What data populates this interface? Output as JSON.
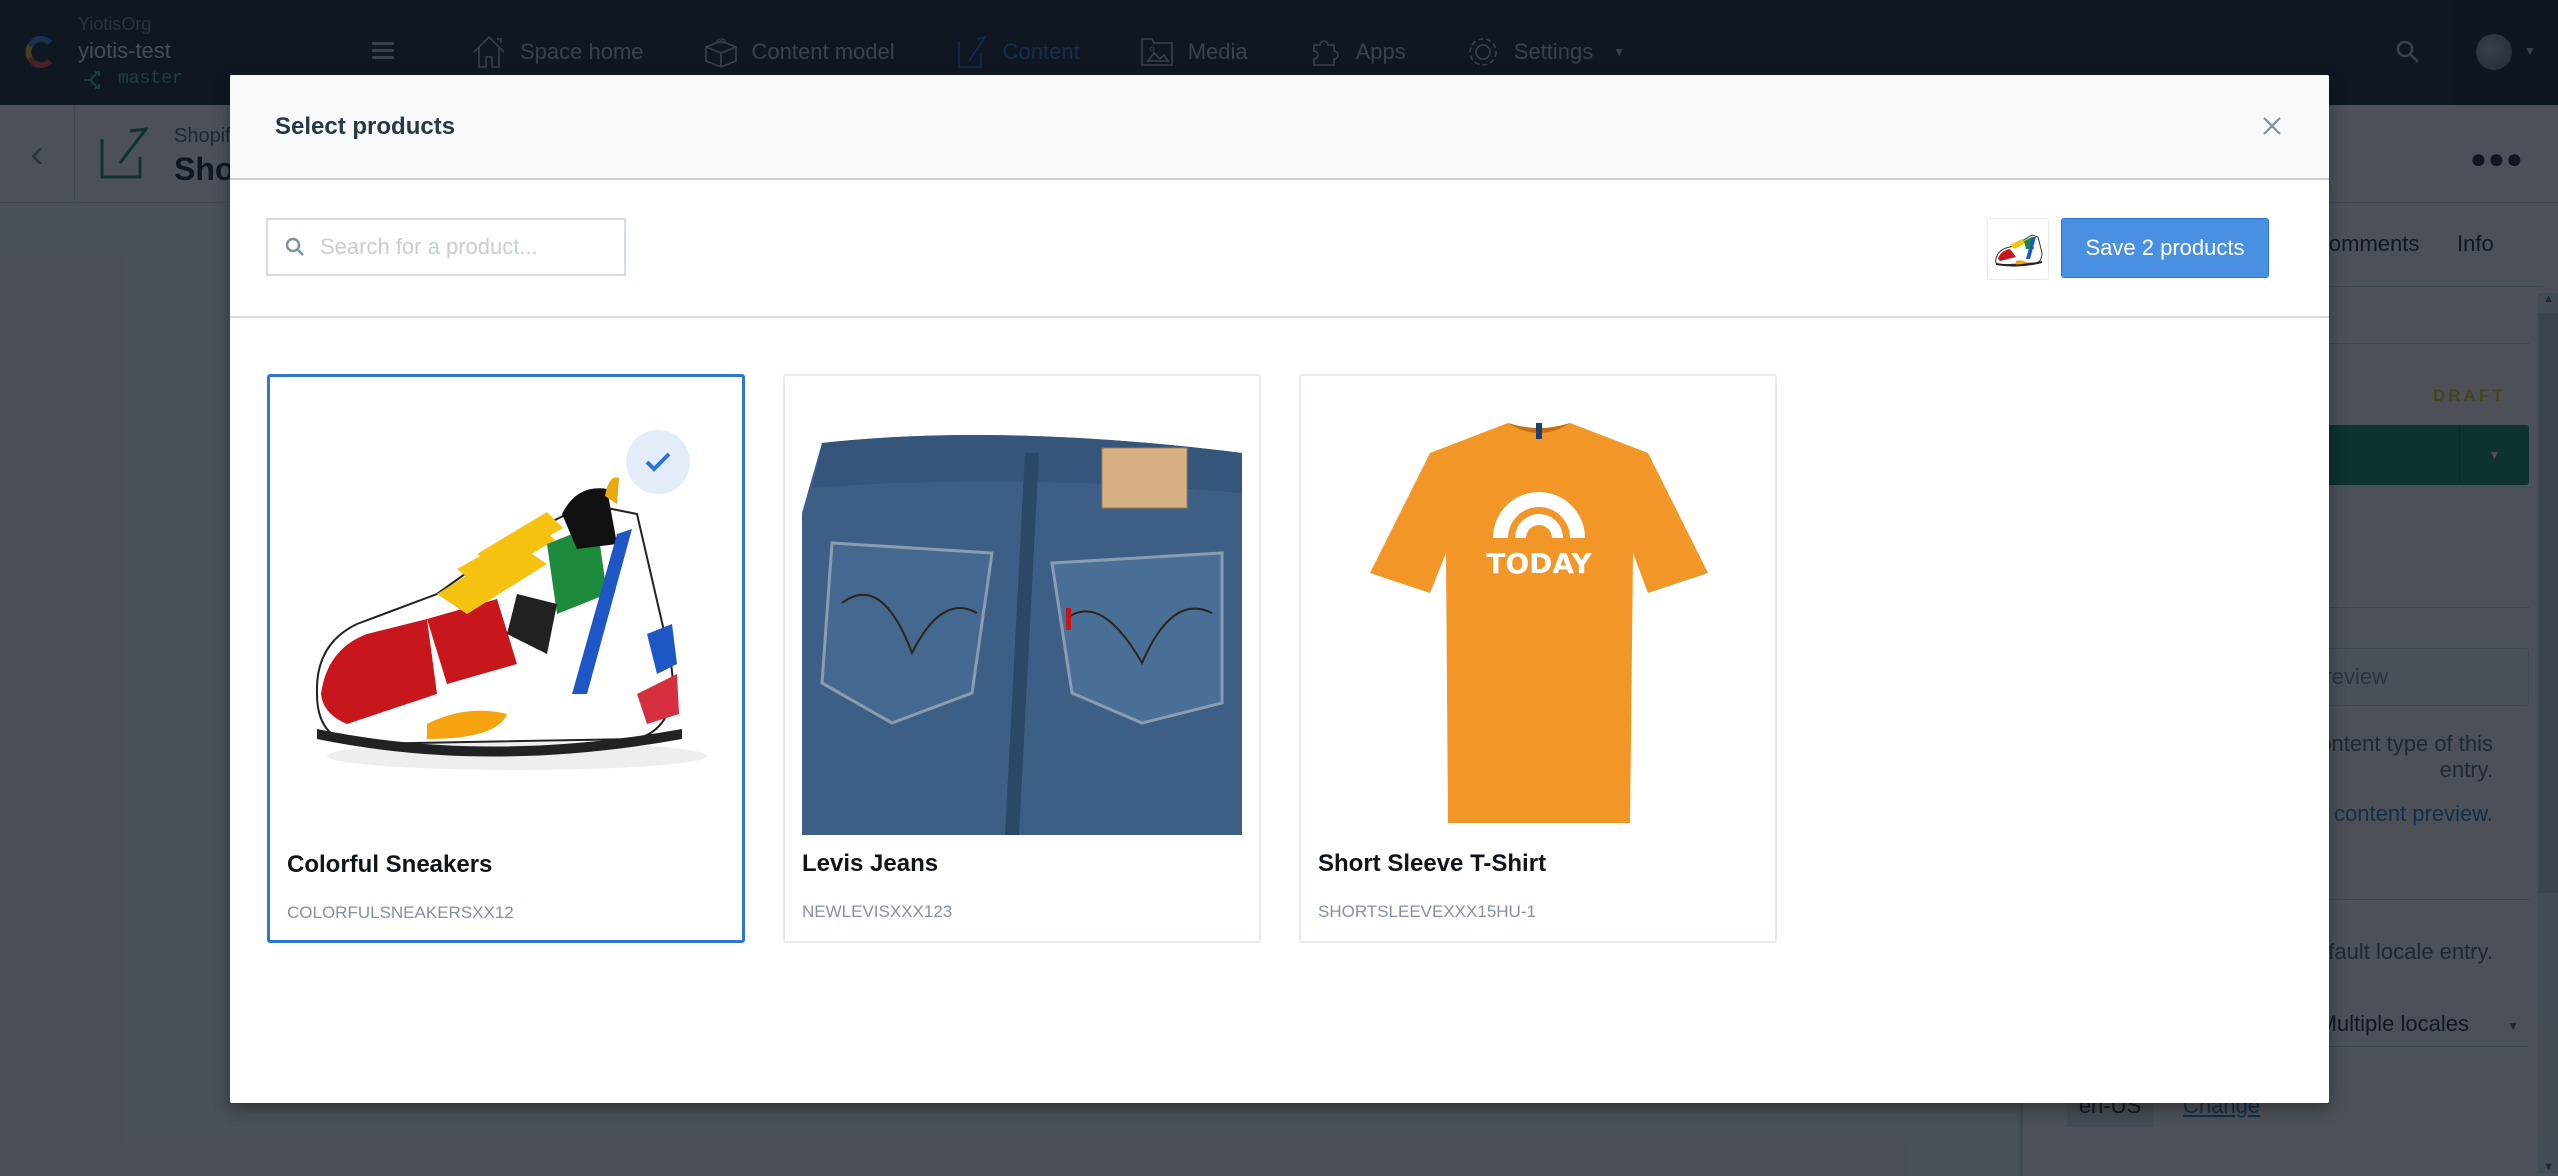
{
  "app": {
    "org_name": "YiotisOrg",
    "space_name": "yiotis-test",
    "environment": "master",
    "nav": [
      {
        "label": "Space home",
        "icon": "home-icon",
        "active": false
      },
      {
        "label": "Content model",
        "icon": "content-model-icon",
        "active": false
      },
      {
        "label": "Content",
        "icon": "content-icon",
        "active": true
      },
      {
        "label": "Media",
        "icon": "media-icon",
        "active": false
      },
      {
        "label": "Apps",
        "icon": "apps-icon",
        "active": false
      },
      {
        "label": "Settings",
        "icon": "settings-icon",
        "active": false
      }
    ]
  },
  "entry": {
    "content_type": "Shopify",
    "title": "Shopify",
    "status": "DRAFT"
  },
  "sidebar": {
    "tabs": [
      "Comments",
      "Info"
    ],
    "preview_label": "Open preview",
    "preview_help": "Set up previews for the content type of this entry.",
    "preview_link": "Set up content preview.",
    "locale_help": "Showing all fields in the default locale entry.",
    "locale_select": "Multiple locales",
    "locale_tag": "en-US",
    "change_link": "Change"
  },
  "modal": {
    "title": "Select products",
    "search": {
      "placeholder": "Search for a product...",
      "value": ""
    },
    "save_button": "Save 2 products",
    "selected_count": 2,
    "products": [
      {
        "name": "Colorful Sneakers",
        "sku": "COLORFULSNEAKERSXX12",
        "selected": true,
        "image": "sneaker"
      },
      {
        "name": "Levis Jeans",
        "sku": "NEWLEVISXXX123",
        "selected": false,
        "image": "jeans"
      },
      {
        "name": "Short Sleeve T-Shirt",
        "sku": "SHORTSLEEVEXXX15HU-1",
        "selected": false,
        "image": "tshirt",
        "print": "TODAY"
      }
    ]
  },
  "colors": {
    "accent": "#2e75d4",
    "button": "#4a90e2",
    "nav_bg": "#192532",
    "publish": "#16875d",
    "draft": "#f7c427"
  }
}
